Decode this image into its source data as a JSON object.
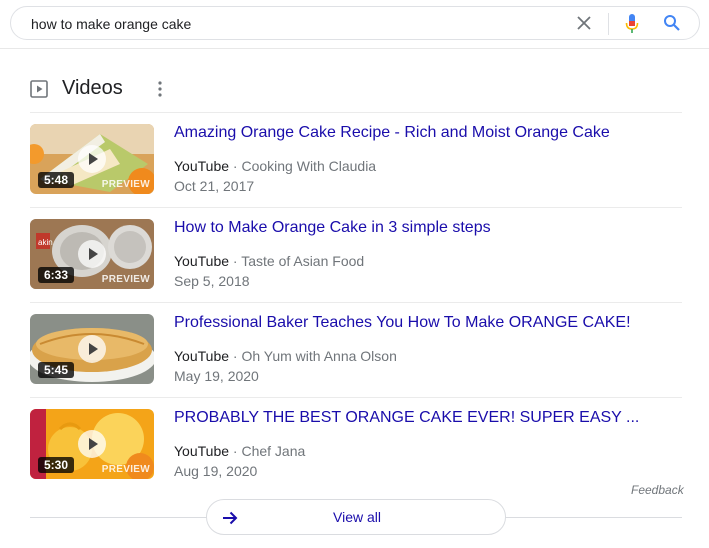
{
  "search": {
    "query": "how to make orange cake"
  },
  "section": {
    "title": "Videos"
  },
  "videos": [
    {
      "title": "Amazing Orange Cake Recipe - Rich and Moist Orange Cake",
      "source": "YouTube",
      "channel": "Cooking With Claudia",
      "date": "Oct 21, 2017",
      "duration": "5:48",
      "preview_label": "PREVIEW"
    },
    {
      "title": "How to Make Orange Cake in 3 simple steps",
      "source": "YouTube",
      "channel": "Taste of Asian Food",
      "date": "Sep 5, 2018",
      "duration": "6:33",
      "preview_label": "PREVIEW"
    },
    {
      "title": "Professional Baker Teaches You How To Make ORANGE CAKE!",
      "source": "YouTube",
      "channel": "Oh Yum with Anna Olson",
      "date": "May 19, 2020",
      "duration": "5:45",
      "preview_label": ""
    },
    {
      "title": "PROBABLY THE BEST ORANGE CAKE EVER! SUPER EASY ...",
      "source": "YouTube",
      "channel": "Chef Jana",
      "date": "Aug 19, 2020",
      "duration": "5:30",
      "preview_label": "PREVIEW"
    }
  ],
  "feedback_label": "Feedback",
  "view_all_label": "View all",
  "separator": " · ",
  "icons": {
    "clear": "close-icon",
    "mic": "microphone-icon",
    "search": "search-icon",
    "section": "video-icon",
    "more": "more-vert-icon",
    "view_all": "arrow-right-icon"
  },
  "colors": {
    "link": "#1a0dab",
    "meta": "#70757a",
    "search_icon": "#4285f4"
  }
}
